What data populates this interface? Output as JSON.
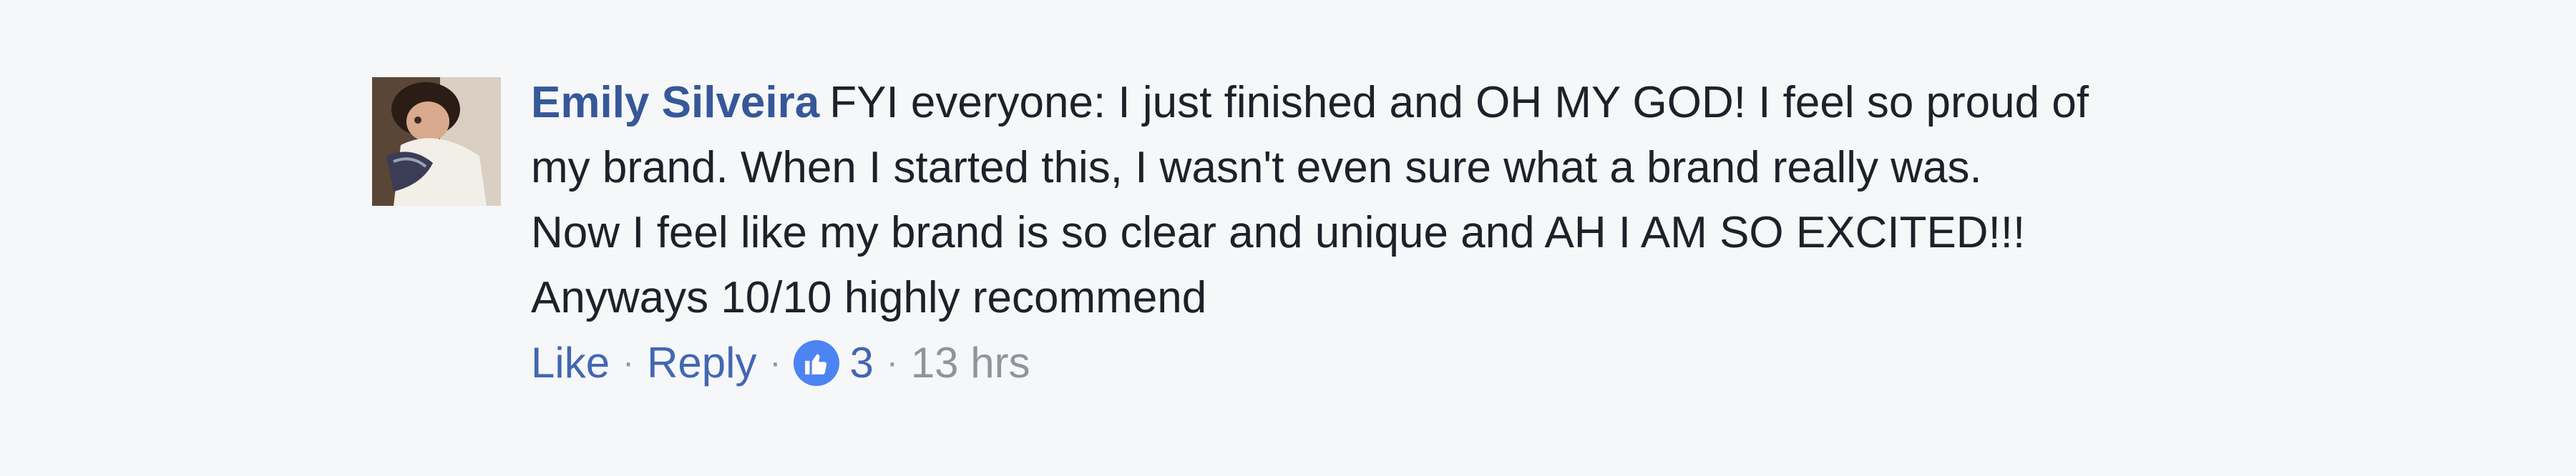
{
  "comment": {
    "author": "Emily Silveira",
    "text_lines": [
      "FYI everyone: I just finished and OH MY GOD! I feel so proud of",
      "my brand. When I started this, I wasn't even sure what a brand really was.",
      "Now I feel like my brand is so clear and unique and AH I AM SO EXCITED!!!",
      "Anyways 10/10 highly recommend"
    ],
    "actions": {
      "like_label": "Like",
      "reply_label": "Reply",
      "separator": "·",
      "reaction_icon": "thumbs-up-icon",
      "reaction_count": "3",
      "timestamp": "13 hrs"
    }
  },
  "colors": {
    "background": "#f6f7f9",
    "author": "#365899",
    "link": "#4267b2",
    "muted": "#90949c",
    "reaction_badge": "#4d84f3"
  }
}
